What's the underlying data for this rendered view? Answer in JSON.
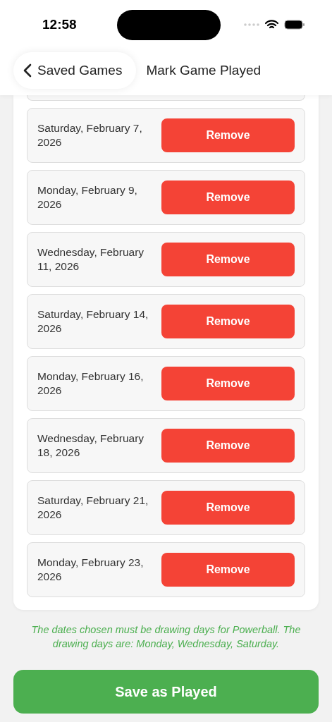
{
  "status_bar": {
    "time": "12:58"
  },
  "nav": {
    "back_label": "Saved Games",
    "title": "Mark Game Played"
  },
  "dates": [
    {
      "date": "Saturday, February 7, 2026",
      "action": "Remove"
    },
    {
      "date": "Monday, February 9, 2026",
      "action": "Remove"
    },
    {
      "date": "Wednesday, February 11, 2026",
      "action": "Remove"
    },
    {
      "date": "Saturday, February 14, 2026",
      "action": "Remove"
    },
    {
      "date": "Monday, February 16, 2026",
      "action": "Remove"
    },
    {
      "date": "Wednesday, February 18, 2026",
      "action": "Remove"
    },
    {
      "date": "Saturday, February 21, 2026",
      "action": "Remove"
    },
    {
      "date": "Monday, February 23, 2026",
      "action": "Remove"
    }
  ],
  "note": "The dates chosen must be drawing days for Powerball. The drawing days are: Monday, Wednesday, Saturday.",
  "save_button": "Save as Played"
}
